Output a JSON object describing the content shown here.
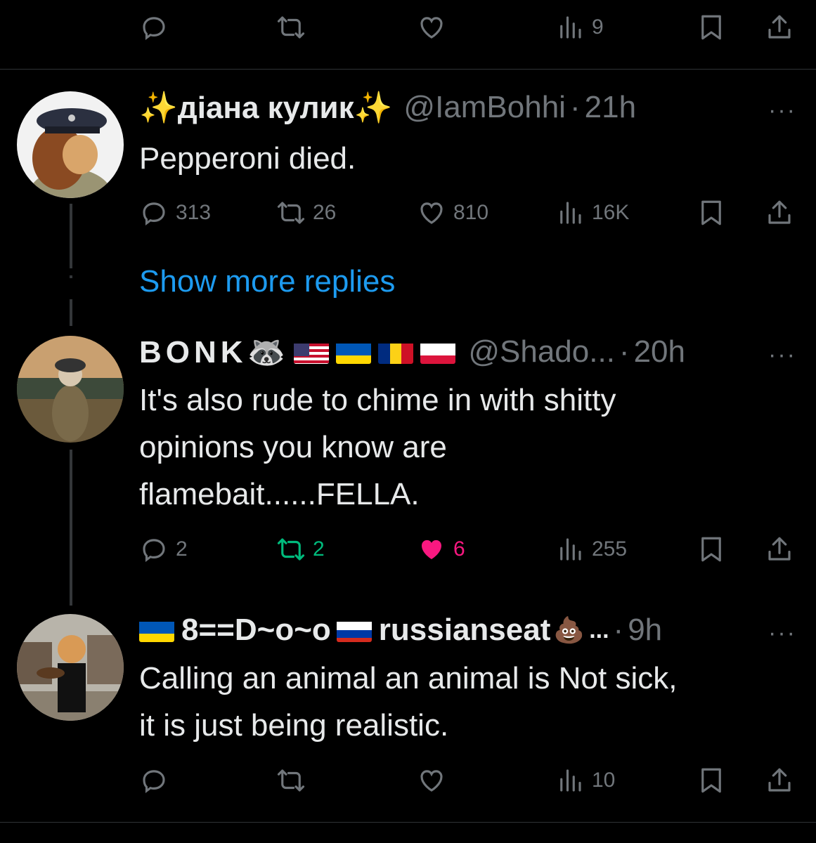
{
  "top_actions": {
    "views": "9"
  },
  "tweets": [
    {
      "name": "✨діана кулик✨",
      "handle": "@IamBohhi",
      "time": "21h",
      "text": "Pepperoni died.",
      "replies": "313",
      "reposts": "26",
      "likes": "810",
      "views": "16K",
      "liked": false,
      "reposted": false
    },
    {
      "name": "BONK🦝",
      "handle": "@Shado...",
      "time": "20h",
      "text": "It's also rude to chime in with shitty\nopinions you know are\nflamebait......FELLA.",
      "replies": "2",
      "reposts": "2",
      "likes": "6",
      "views": "255",
      "liked": true,
      "reposted": true
    },
    {
      "name_prefix": "8==D~o~o",
      "name_suffix": "russianseat",
      "name_emoji": "💩",
      "ellipsis": "...",
      "time": "9h",
      "text": "Calling an animal an animal is Not sick,\nit is just being realistic.",
      "views": "10"
    }
  ],
  "show_more": "Show more replies",
  "more_label": "···",
  "separator": "·",
  "colors": {
    "link": "#1d9bf0",
    "like": "#f91880",
    "repost": "#00ba7c",
    "muted": "#71767b"
  }
}
